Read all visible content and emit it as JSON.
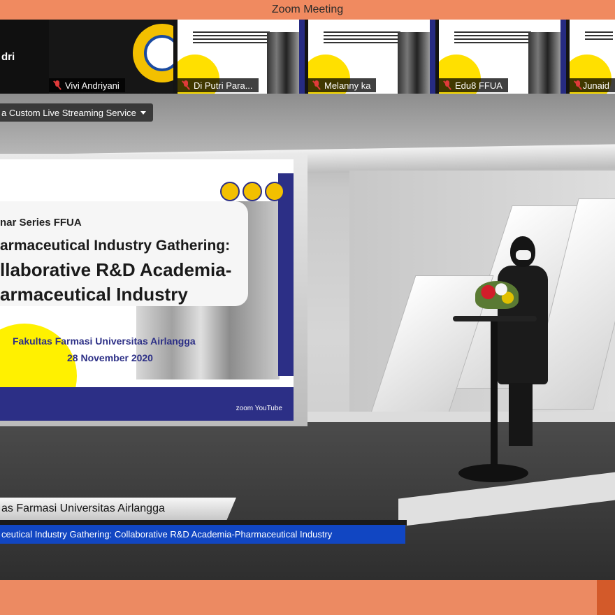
{
  "window": {
    "title": "Zoom Meeting"
  },
  "participants": {
    "first_partial_name": "dri",
    "tiles": [
      {
        "name": "Vivi Andriyani",
        "muted": true,
        "content": "logo"
      },
      {
        "name": "Di Putri Para...",
        "muted": true,
        "content": "slide-thumbnail"
      },
      {
        "name": "Melanny ka",
        "muted": true,
        "content": "slide-thumbnail"
      },
      {
        "name": "Edu8 FFUA",
        "muted": true,
        "content": "slide-thumbnail"
      },
      {
        "name": "Junaid",
        "muted": true,
        "content": "slide-thumbnail"
      }
    ]
  },
  "streaming": {
    "label": "a Custom Live Streaming Service",
    "icon": "chevron-down-icon"
  },
  "slide": {
    "series": "nar Series FFUA",
    "title_line1": "armaceutical Industry Gathering:",
    "title_line2": "llaborative R&D Academia-",
    "title_line3": "armaceutical Industry",
    "organizer": "Fakultas Farmasi Universitas Airlangga",
    "date": "28 November 2020",
    "footer": "zoom  YouTube"
  },
  "lower_third": {
    "org": "as Farmasi Universitas Airlangga",
    "event": "ceutical Industry Gathering: Collaborative R&D Academia-Pharmaceutical Industry"
  },
  "colors": {
    "window_accent": "#f08a60",
    "slide_blue": "#2c2f86",
    "slide_yellow": "#fff100",
    "lower_third_blue": "#1146c2"
  }
}
